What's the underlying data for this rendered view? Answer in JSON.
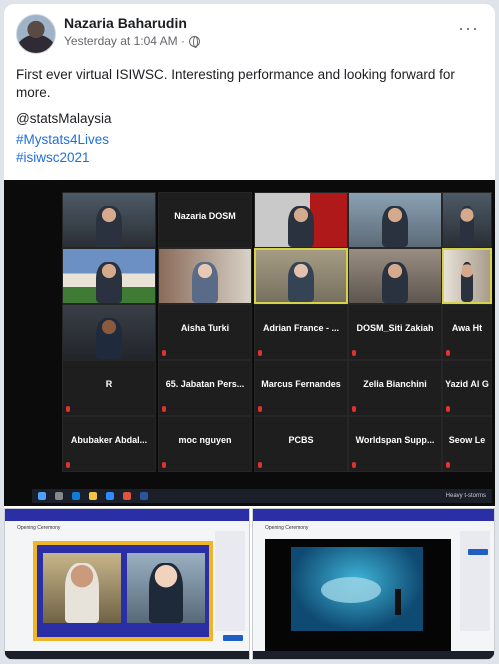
{
  "post": {
    "author": "Nazaria Baharudin",
    "timestamp": "Yesterday at 1:04 AM ·",
    "text": "First ever virtual ISIWSC. Interesting performance and looking forward for more.",
    "mention": "@statsMalaysia",
    "hashtags": [
      "#Mystats4Lives",
      "#isiwsc2021"
    ],
    "more_label": "···"
  },
  "zoom": {
    "video_captions": [
      "",
      "",
      "",
      "",
      "",
      "",
      "",
      "",
      "",
      "",
      "",
      ""
    ],
    "names": [
      "Nazaria DOSM",
      "Aisha Turki",
      "Adrian France - ...",
      "DOSM_Siti Zakiah",
      "Awa Ht",
      "R",
      "65. Jabatan Pers...",
      "Marcus Fernandes",
      "Zelia Bianchini",
      "Yazid Al G",
      "Abubaker Abdal...",
      "moc nguyen",
      "PCBS",
      "Worldspan Supp...",
      "Seow Le"
    ],
    "taskbar_text": "Heavy t-storms"
  },
  "screenshots": {
    "left_title": "Opening Ceremony",
    "right_title": "Opening Ceremony"
  },
  "colors": {
    "link": "#216fdb",
    "zoom_bg": "#0b0b0b",
    "mic_muted": "#e0332f",
    "active_speaker": "#d6d24a",
    "site_header": "#2b2fa6"
  }
}
